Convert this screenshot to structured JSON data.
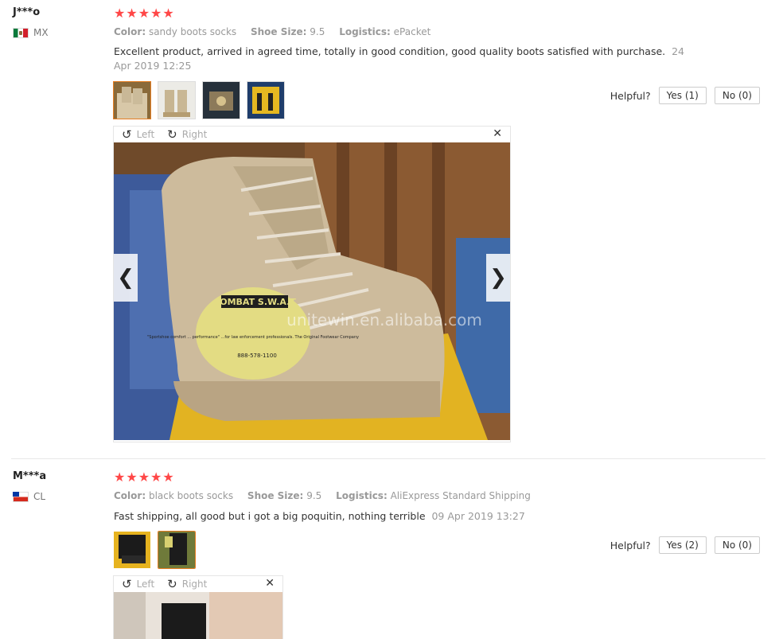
{
  "labels": {
    "color": "Color:",
    "shoe_size": "Shoe Size:",
    "logistics": "Logistics:",
    "helpful": "Helpful?",
    "left": "Left",
    "right": "Right"
  },
  "reviews": [
    {
      "user": "J***o",
      "country": "MX",
      "stars": "★★★★★",
      "color": "sandy boots socks",
      "shoe_size": "9.5",
      "logistics": "ePacket",
      "text": "Excellent product, arrived in agreed time, totally in good condition, good quality boots satisfied with purchase.",
      "date": "24 Apr 2019 12:25",
      "yes": "Yes (1)",
      "no": "No (0)",
      "photo_caption": "COMBAT S.W.A.T",
      "photo_tag": "\"Sportshoe comfort ... performance\" ...for law enforcement professionals. The Original Footwear Company",
      "photo_phone": "888-578-1100",
      "watermark": "unitewin.en.alibaba.com"
    },
    {
      "user": "M***a",
      "country": "CL",
      "stars": "★★★★★",
      "color": "black boots socks",
      "shoe_size": "9.5",
      "logistics": "AliExpress Standard Shipping",
      "text": "Fast shipping, all good but i got a big poquitin, nothing terrible",
      "date": "09 Apr 2019 13:27",
      "yes": "Yes (2)",
      "no": "No (0)"
    }
  ]
}
